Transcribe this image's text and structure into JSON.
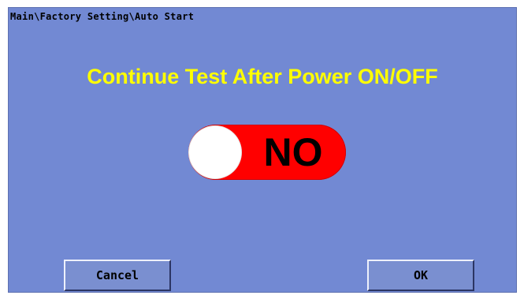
{
  "breadcrumb": "Main\\Factory Setting\\Auto Start",
  "title": "Continue Test After Power ON/OFF",
  "toggle": {
    "state_label": "NO",
    "color": "#ff0000"
  },
  "buttons": {
    "cancel_label": "Cancel",
    "ok_label": "OK"
  },
  "colors": {
    "background": "#7289d3",
    "title": "#ffff00"
  }
}
